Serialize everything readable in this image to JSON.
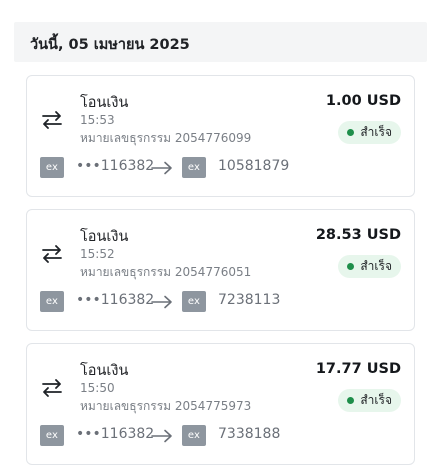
{
  "date_header": "วันนี้, 05 เมษายน 2025",
  "colors": {
    "success": "#1e8e4a",
    "status_bg": "#e7f6ec",
    "badge": "#8e969f"
  },
  "icons": {
    "transfer": "swap-horizontal-icon",
    "direction": "arrow-right-icon",
    "account": "ex-badge"
  },
  "transactions": [
    {
      "title": "โอนเงิน",
      "time": "15:53",
      "reference": "หมายเลขธุรกรรม 2054776099",
      "amount": "1.00 USD",
      "status": "สำเร็จ",
      "from_badge": "ex",
      "from_account": "•••116382",
      "to_badge": "ex",
      "to_account": "10581879"
    },
    {
      "title": "โอนเงิน",
      "time": "15:52",
      "reference": "หมายเลขธุรกรรม 2054776051",
      "amount": "28.53 USD",
      "status": "สำเร็จ",
      "from_badge": "ex",
      "from_account": "•••116382",
      "to_badge": "ex",
      "to_account": "7238113"
    },
    {
      "title": "โอนเงิน",
      "time": "15:50",
      "reference": "หมายเลขธุรกรรม 2054775973",
      "amount": "17.77 USD",
      "status": "สำเร็จ",
      "from_badge": "ex",
      "from_account": "•••116382",
      "to_badge": "ex",
      "to_account": "7338188"
    }
  ]
}
